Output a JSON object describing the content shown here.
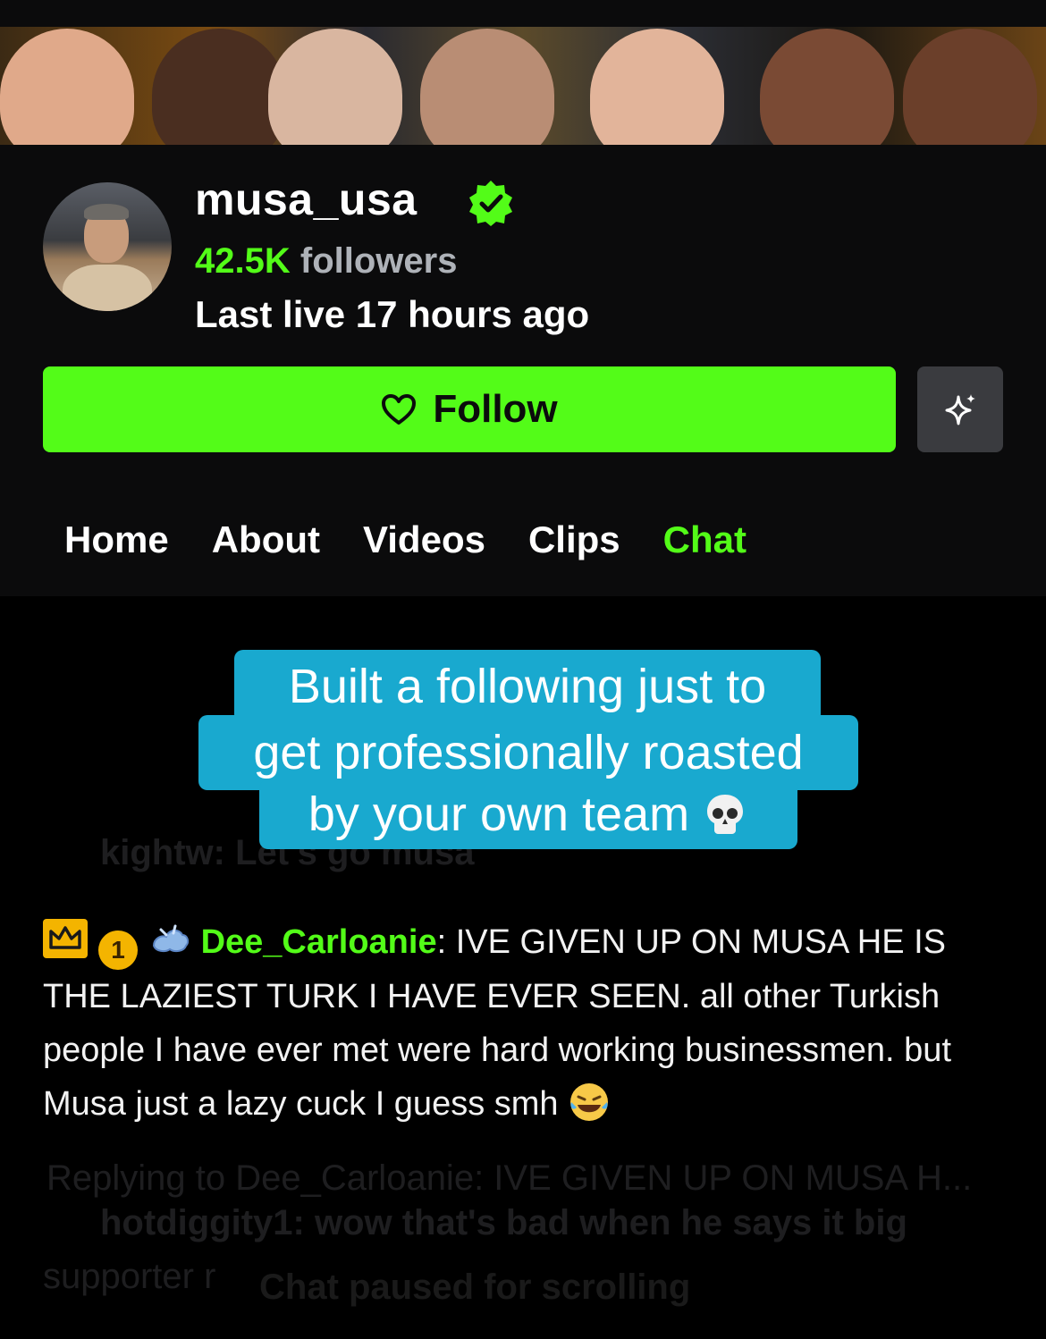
{
  "profile": {
    "username": "musa_usa",
    "followers_count": "42.5K",
    "followers_label": "followers",
    "last_live": "Last live 17 hours ago",
    "verified_icon": "verified-check-icon"
  },
  "actions": {
    "follow_label": "Follow",
    "follow_icon": "heart-outline-icon",
    "extra_icon": "sparkle-icon"
  },
  "tabs": [
    {
      "label": "Home",
      "active": false
    },
    {
      "label": "About",
      "active": false
    },
    {
      "label": "Videos",
      "active": false
    },
    {
      "label": "Clips",
      "active": false
    },
    {
      "label": "Chat",
      "active": true
    }
  ],
  "caption": {
    "line1": "Built a following just to",
    "line2": "get professionally roasted",
    "line3": "by your own team"
  },
  "chat": {
    "badge_count": "1",
    "highlight_user": "Dee_Carloanie",
    "highlight_text": "IVE GIVEN UP ON MUSA HE IS THE LAZIEST TURK I HAVE EVER SEEN. all other Turkish people I have ever met were hard working businessmen. but Musa just a lazy cuck I guess smh",
    "faint_line_1": "kightw: Let's go musa",
    "faint_reply": "Replying to Dee_Carloanie: IVE GIVEN UP ON MUSA H...",
    "faint_line_2": "hotdiggity1: wow that's bad when he says it big",
    "faint_line_3": "supporter r",
    "paused_label": "Chat paused for scrolling"
  },
  "colors": {
    "accent": "#53fc18",
    "caption_bg": "#19a9cf",
    "background": "#0b0b0c"
  }
}
